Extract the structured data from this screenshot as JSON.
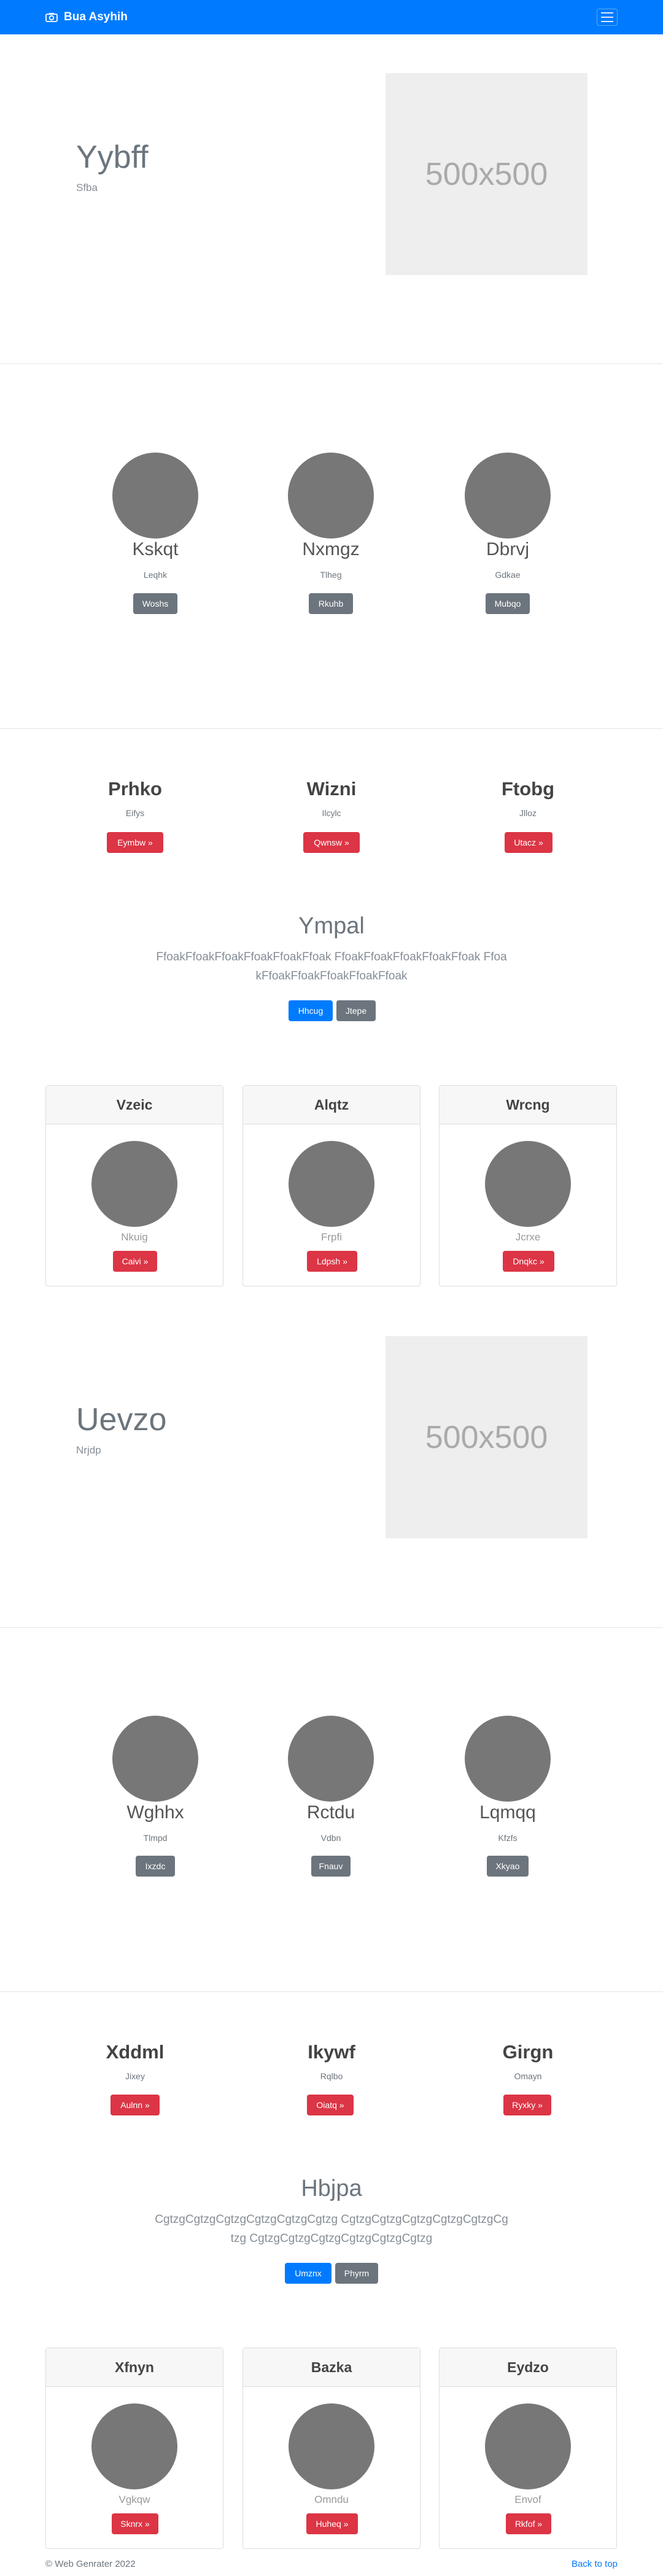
{
  "navbar": {
    "brand": "Bua Asyhih",
    "brand_icon": "camera-icon",
    "toggle_icon": "hamburger-menu-icon"
  },
  "hero1": {
    "title": "Yybff",
    "subtitle": "Sfba",
    "placeholder": "500x500"
  },
  "team1": [
    {
      "name": "Kskqt",
      "role": "Leqhk",
      "button": "Woshs"
    },
    {
      "name": "Nxmgz",
      "role": "Tlheg",
      "button": "Rkuhb"
    },
    {
      "name": "Dbrvj",
      "role": "Gdkae",
      "button": "Mubqo"
    }
  ],
  "features1": [
    {
      "title": "Prhko",
      "subtitle": "Eifys",
      "button": "Eymbw »"
    },
    {
      "title": "Wizni",
      "subtitle": "Ilcylc",
      "button": "Qwnsw »"
    },
    {
      "title": "Ftobg",
      "subtitle": "Jlloz",
      "button": "Utacz »"
    }
  ],
  "lead1": {
    "title": "Ympal",
    "text": "FfoakFfoakFfoakFfoakFfoakFfoak FfoakFfoakFfoakFfoakFfoak FfoakFfoakFfoakFfoakFfoakFfoak",
    "primary": "Hhcug",
    "secondary": "Jtepe"
  },
  "cards1": [
    {
      "header": "Vzeic",
      "label": "Nkuig",
      "button": "Caivi »"
    },
    {
      "header": "Alqtz",
      "label": "Frpfi",
      "button": "Ldpsh »"
    },
    {
      "header": "Wrcng",
      "label": "Jcrxe",
      "button": "Dnqkc »"
    }
  ],
  "hero2": {
    "title": "Uevzo",
    "subtitle": "Nrjdp",
    "placeholder": "500x500"
  },
  "team2": [
    {
      "name": "Wghhx",
      "role": "Tlmpd",
      "button": "Ixzdc"
    },
    {
      "name": "Rctdu",
      "role": "Vdbn",
      "button": "Fnauv"
    },
    {
      "name": "Lqmqq",
      "role": "Kfzfs",
      "button": "Xkyao"
    }
  ],
  "features2": [
    {
      "title": "Xddml",
      "subtitle": "Jixey",
      "button": "Aulnn »"
    },
    {
      "title": "Ikywf",
      "subtitle": "Rqlbo",
      "button": "Oiatq »"
    },
    {
      "title": "Girgn",
      "subtitle": "Omayn",
      "button": "Ryxky »"
    }
  ],
  "lead2": {
    "title": "Hbjpa",
    "text": "CgtzgCgtzgCgtzgCgtzgCgtzgCgtzg CgtzgCgtzgCgtzgCgtzgCgtzgCgtzg CgtzgCgtzgCgtzgCgtzgCgtzgCgtzg",
    "primary": "Umznx",
    "secondary": "Phyrm"
  },
  "cards2": [
    {
      "header": "Xfnyn",
      "label": "Vgkqw",
      "button": "Sknrx »"
    },
    {
      "header": "Bazka",
      "label": "Omndu",
      "button": "Huheq »"
    },
    {
      "header": "Eydzo",
      "label": "Envof",
      "button": "Rkfof »"
    }
  ],
  "footer": {
    "copyright": "© Web Genrater 2022",
    "back_to_top": "Back to top"
  }
}
